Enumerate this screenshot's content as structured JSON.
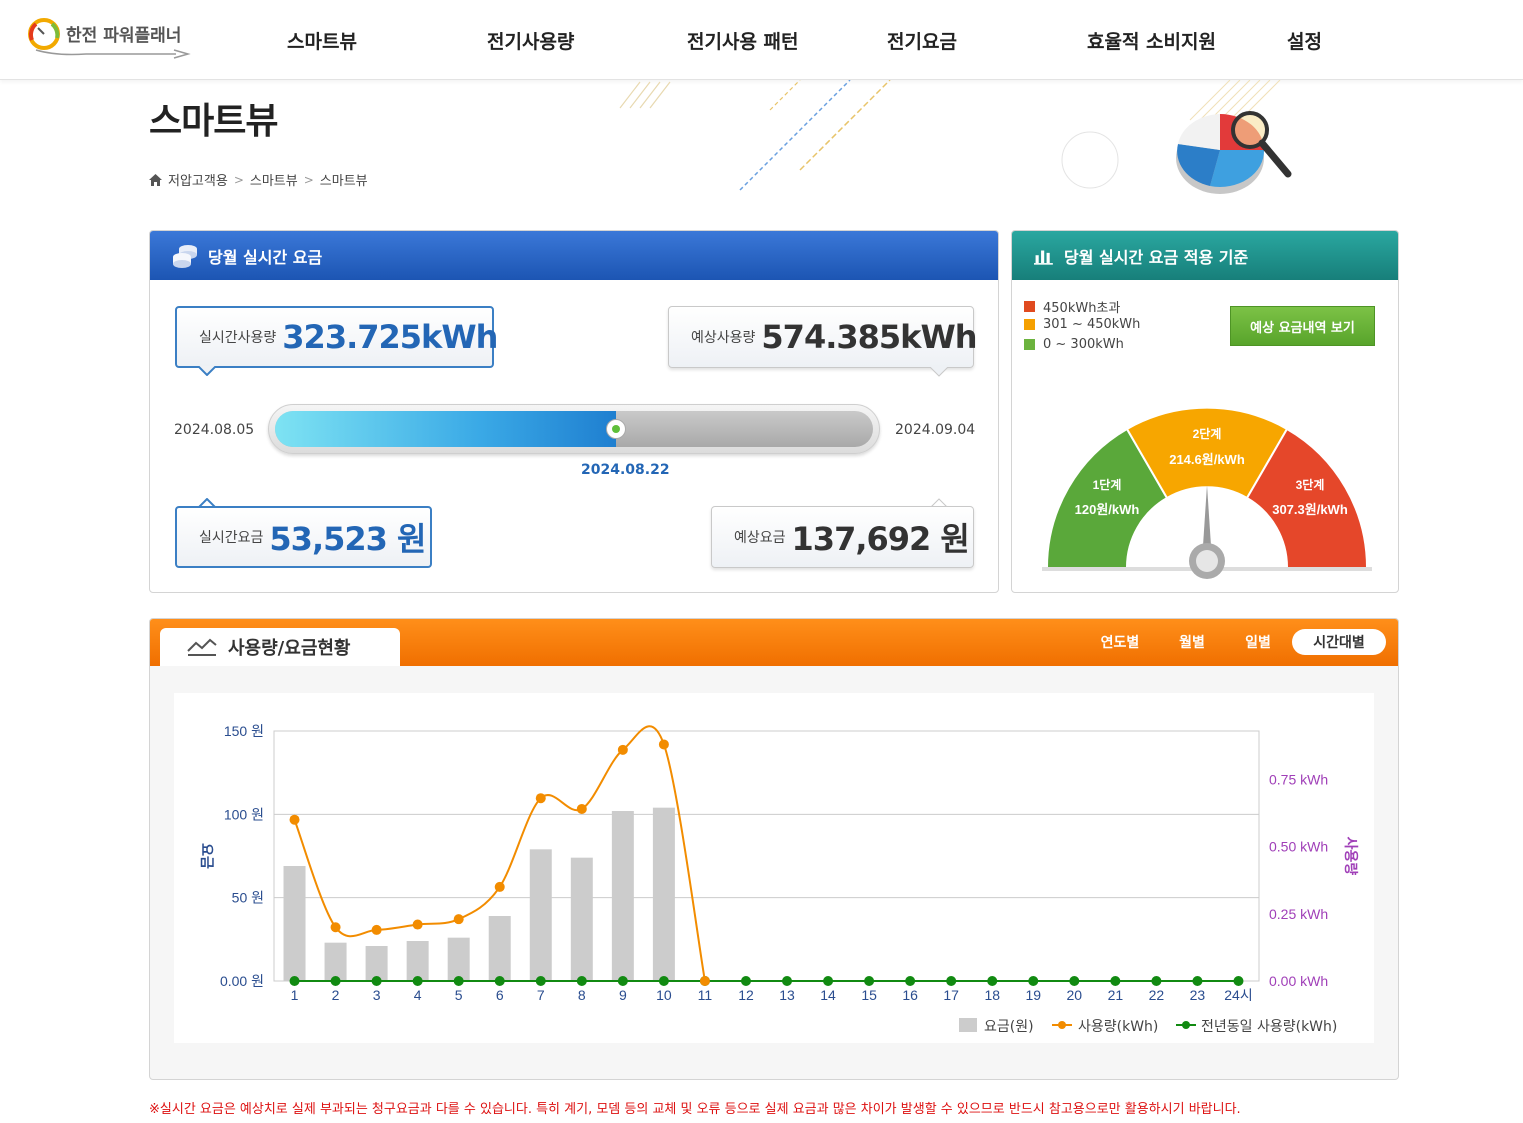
{
  "header": {
    "logo_text": "한전 파워플래너",
    "nav": [
      "스마트뷰",
      "전기사용량",
      "전기사용 패턴",
      "전기요금",
      "효율적 소비지원",
      "설정"
    ]
  },
  "page": {
    "title": "스마트뷰",
    "breadcrumb": [
      "저압고객용",
      "스마트뷰",
      "스마트뷰"
    ]
  },
  "realtime": {
    "title": "당월 실시간 요금",
    "usage_label": "실시간사용량",
    "usage_value": "323.725kWh",
    "expected_usage_label": "예상사용량",
    "expected_usage_value": "574.385kWh",
    "start_date": "2024.08.05",
    "end_date": "2024.09.04",
    "current_date": "2024.08.22",
    "progress": 0.57,
    "fee_label": "실시간요금",
    "fee_value": "53,523 원",
    "expected_fee_label": "예상요금",
    "expected_fee_value": "137,692 원"
  },
  "criteria": {
    "title": "당월 실시간 요금 적용 기준",
    "legend": [
      {
        "label": "450kWh초과",
        "color": "#e04a1f"
      },
      {
        "label": "301 ~ 450kWh",
        "color": "#f5a000"
      },
      {
        "label": "0 ~ 300kWh",
        "color": "#6cb33e"
      }
    ],
    "button": "예상 요금내역 보기",
    "gauge": {
      "tier1_name": "1단계",
      "tier1_price": "120원/kWh",
      "tier2_name": "2단계",
      "tier2_price": "214.6원/kWh",
      "tier3_name": "3단계",
      "tier3_price": "307.3원/kWh",
      "needle_fraction": 0.5
    }
  },
  "usage_panel": {
    "title": "사용량/요금현황",
    "tabs": [
      "연도별",
      "월별",
      "일별",
      "시간대별"
    ],
    "active_tab": "시간대별"
  },
  "chart_data": {
    "type": "bar",
    "categories": [
      "1",
      "2",
      "3",
      "4",
      "5",
      "6",
      "7",
      "8",
      "9",
      "10",
      "11",
      "12",
      "13",
      "14",
      "15",
      "16",
      "17",
      "18",
      "19",
      "20",
      "21",
      "22",
      "23",
      "24시"
    ],
    "y_left_label": "요금",
    "y_right_label": "사용량",
    "y_left_ticks": [
      "0.00 원",
      "50 원",
      "100 원",
      "150 원"
    ],
    "y_right_ticks": [
      "0.00 kWh",
      "0.25 kWh",
      "0.50 kWh",
      "0.75 kWh"
    ],
    "ylim_left": [
      0,
      150
    ],
    "ylim_right": [
      0,
      0.93
    ],
    "series": [
      {
        "name": "요금(원)",
        "type": "bar",
        "color": "#cccccc",
        "values": [
          69,
          23,
          21,
          24,
          26,
          39,
          79,
          74,
          102,
          104,
          0,
          0,
          0,
          0,
          0,
          0,
          0,
          0,
          0,
          0,
          0,
          0,
          0,
          0
        ]
      },
      {
        "name": "사용량(kWh)",
        "type": "line",
        "color": "#f28c00",
        "values": [
          0.6,
          0.2,
          0.19,
          0.21,
          0.23,
          0.35,
          0.68,
          0.64,
          0.86,
          0.88,
          0,
          0,
          0,
          0,
          0,
          0,
          0,
          0,
          0,
          0,
          0,
          0,
          0,
          0
        ]
      },
      {
        "name": "전년동일 사용량(kWh)",
        "type": "line",
        "color": "#118a11",
        "values": [
          0,
          0,
          0,
          0,
          0,
          0,
          0,
          0,
          0,
          0,
          0,
          0,
          0,
          0,
          0,
          0,
          0,
          0,
          0,
          0,
          0,
          0,
          0,
          0
        ]
      }
    ]
  },
  "notice": "※실시간 요금은 예상치로 실제 부과되는 청구요금과 다를 수 있습니다. 특히 계기, 모뎀 등의 교체 및 오류 등으로 실제 요금과 많은 차이가 발생할 수 있으므로 반드시 참고용으로만 활용하시기 바랍니다."
}
